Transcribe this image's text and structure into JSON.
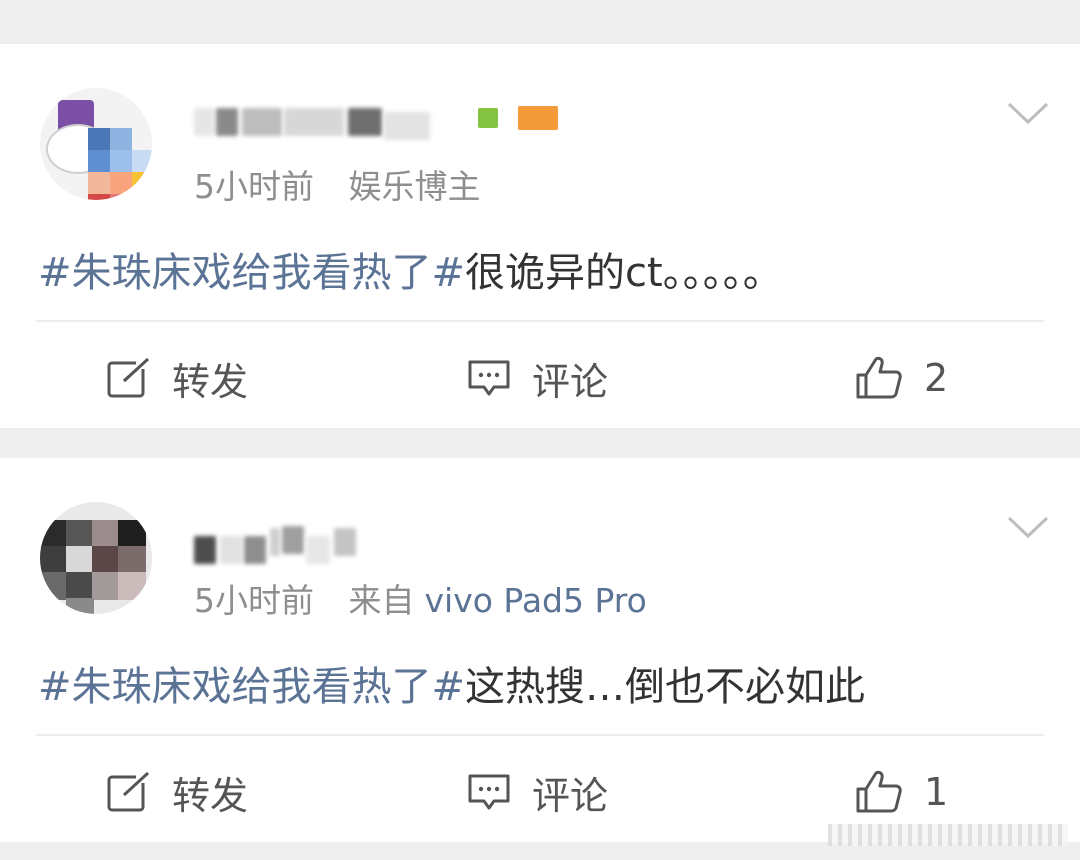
{
  "posts": [
    {
      "username_visible": "",
      "time": "5小时前",
      "role": "娱乐博主",
      "device": "",
      "topic": "#朱珠床戏给我看热了#",
      "text": "很诡异的ct。。。。。",
      "actions": {
        "repost": "转发",
        "comment": "评论",
        "like": "2"
      }
    },
    {
      "username_visible": "",
      "time": "5小时前",
      "role": "来自",
      "device": "vivo Pad5 Pro",
      "topic": "#朱珠床戏给我看热了#",
      "text": "这热搜…倒也不必如此",
      "actions": {
        "repost": "转发",
        "comment": "评论",
        "like": "1"
      }
    }
  ],
  "colors": {
    "topic": "#5b7395",
    "meta": "#8e8e8e",
    "background": "#efefef"
  },
  "icons": [
    "repost-icon",
    "comment-icon",
    "like-icon",
    "chevron-down-icon"
  ]
}
